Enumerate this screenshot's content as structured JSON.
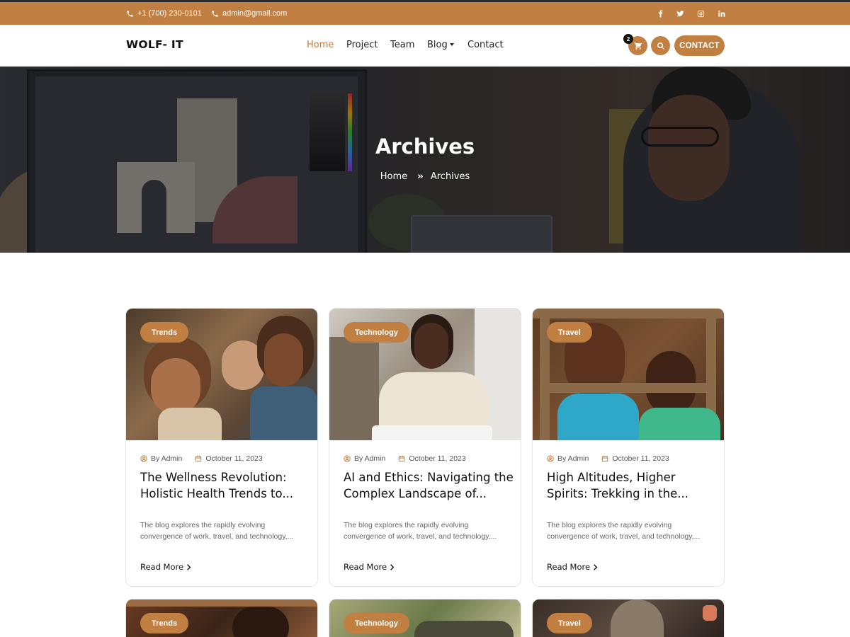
{
  "topbar": {
    "phone": "+1 (700) 230-0101",
    "email": "admin@gmail.com",
    "social": [
      "facebook-icon",
      "twitter-icon",
      "instagram-icon",
      "linkedin-icon"
    ]
  },
  "navbar": {
    "logo": "WOLF- IT",
    "links": [
      "Home",
      "Project",
      "Team",
      "Blog",
      "Contact"
    ],
    "active_link": "Home",
    "cart_count": "2",
    "contact_button": "CONTACT"
  },
  "hero": {
    "title": "Archives",
    "breadcrumb": [
      "Home",
      "Archives"
    ]
  },
  "posts": [
    {
      "tag": "Trends",
      "author": "By Admin",
      "date": "October 11, 2023",
      "title": "The Wellness Revolution: Holistic Health Trends to...",
      "excerpt": "The blog explores the rapidly evolving convergence of work, travel, and technology,...",
      "read_more": "Read More"
    },
    {
      "tag": "Technology",
      "author": "By Admin",
      "date": "October 11, 2023",
      "title": "AI and Ethics: Navigating the Complex Landscape of...",
      "excerpt": "The blog explores the rapidly evolving convergence of work, travel, and technology,...",
      "read_more": "Read More"
    },
    {
      "tag": "Travel",
      "author": "By Admin",
      "date": "October 11, 2023",
      "title": "High Altitudes, Higher Spirits: Trekking in the...",
      "excerpt": "The blog explores the rapidly evolving convergence of work, travel, and technology,...",
      "read_more": "Read More"
    }
  ],
  "posts_row2_tags": [
    "Trends",
    "Technology",
    "Travel"
  ],
  "colors": {
    "accent": "#c17f41",
    "dark": "#111111"
  }
}
